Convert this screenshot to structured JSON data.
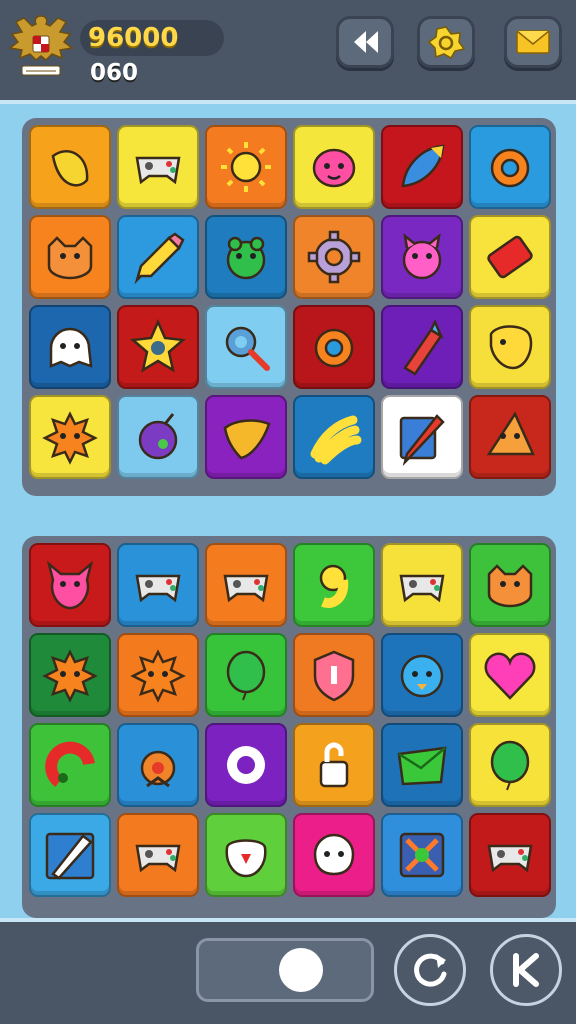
{
  "header": {
    "score": "96000",
    "sub_score": "060",
    "buttons": [
      {
        "name": "back-button",
        "icon": "double-arrow-left-icon"
      },
      {
        "name": "reward-button",
        "icon": "star-badge-icon"
      },
      {
        "name": "mail-button",
        "icon": "envelope-icon"
      }
    ]
  },
  "boards": {
    "top": [
      {
        "bg": "#f7a21b",
        "icon": "banana-icon"
      },
      {
        "bg": "#f6e53a",
        "icon": "gamepad-icon"
      },
      {
        "bg": "#f47b20",
        "icon": "sun-icon"
      },
      {
        "bg": "#f5e63c",
        "icon": "pink-blob-icon"
      },
      {
        "bg": "#c4161c",
        "icon": "rocket-icon"
      },
      {
        "bg": "#2b9be0",
        "icon": "ring-bear-icon"
      },
      {
        "bg": "#f7831f",
        "icon": "fox-face-icon"
      },
      {
        "bg": "#2d9ae0",
        "icon": "pencil-icon"
      },
      {
        "bg": "#1f7dbf",
        "icon": "green-frog-icon"
      },
      {
        "bg": "#f0842a",
        "icon": "gear-icon"
      },
      {
        "bg": "#7a28c2",
        "icon": "pink-monster-icon"
      },
      {
        "bg": "#f8e23c",
        "icon": "red-ticket-icon"
      },
      {
        "bg": "#1c67ae",
        "icon": "ghost-bubble-icon"
      },
      {
        "bg": "#c51a1a",
        "icon": "star-icon"
      },
      {
        "bg": "#7fcdf0",
        "icon": "magnifier-gear-icon"
      },
      {
        "bg": "#b8161a",
        "icon": "orange-ring-icon"
      },
      {
        "bg": "#6e1fb8",
        "icon": "crayon-icon"
      },
      {
        "bg": "#f6df3a",
        "icon": "puzzle-face-icon"
      },
      {
        "bg": "#f7e43c",
        "icon": "spiky-sun-icon"
      },
      {
        "bg": "#7ecaee",
        "icon": "bomb-icon"
      },
      {
        "bg": "#8a22bf",
        "icon": "leaf-heart-icon"
      },
      {
        "bg": "#1f7cc0",
        "icon": "banana-bunch-icon"
      },
      {
        "bg": "#ffffff",
        "icon": "pen-icon"
      },
      {
        "bg": "#c8281b",
        "icon": "pizza-slice-icon"
      }
    ],
    "bottom": [
      {
        "bg": "#c81a1a",
        "icon": "pink-devil-icon"
      },
      {
        "bg": "#2a92d8",
        "icon": "blue-gamepad-icon"
      },
      {
        "bg": "#f47c1f",
        "icon": "white-gamepad-icon"
      },
      {
        "bg": "#3cc83a",
        "icon": "yellow-nine-icon"
      },
      {
        "bg": "#f6e13a",
        "icon": "purple-gamepad-icon"
      },
      {
        "bg": "#3ec23b",
        "icon": "cat-face-icon"
      },
      {
        "bg": "#1f8a3a",
        "icon": "orange-sun-icon"
      },
      {
        "bg": "#f47a1e",
        "icon": "burst-icon"
      },
      {
        "bg": "#38c43a",
        "icon": "green-blob-icon"
      },
      {
        "bg": "#f07a22",
        "icon": "shield-icon"
      },
      {
        "bg": "#1e74bb",
        "icon": "blue-bird-icon"
      },
      {
        "bg": "#f7e63c",
        "icon": "heart-icon"
      },
      {
        "bg": "#3ec23a",
        "icon": "red-swirl-icon"
      },
      {
        "bg": "#2a90d8",
        "icon": "orange-bell-icon"
      },
      {
        "bg": "#7b22c0",
        "icon": "white-ring-icon"
      },
      {
        "bg": "#f4a11e",
        "icon": "padlock-icon"
      },
      {
        "bg": "#1e73b8",
        "icon": "green-envelope-icon"
      },
      {
        "bg": "#f7e23a",
        "icon": "green-balloon-icon"
      },
      {
        "bg": "#3aa9e6",
        "icon": "paintbrush-icon"
      },
      {
        "bg": "#f47a1f",
        "icon": "grey-gamepad-icon"
      },
      {
        "bg": "#5fd03b",
        "icon": "red-face-icon"
      },
      {
        "bg": "#ec1f8a",
        "icon": "skull-icon"
      },
      {
        "bg": "#2f8fdc",
        "icon": "splash-icon"
      },
      {
        "bg": "#c21a1a",
        "icon": "white-controller-icon"
      }
    ]
  },
  "footer": {
    "slider_value": 0.5,
    "buttons": [
      {
        "name": "refresh-button",
        "icon": "refresh-icon"
      },
      {
        "name": "menu-k-button",
        "icon": "k-letter-icon"
      }
    ]
  }
}
